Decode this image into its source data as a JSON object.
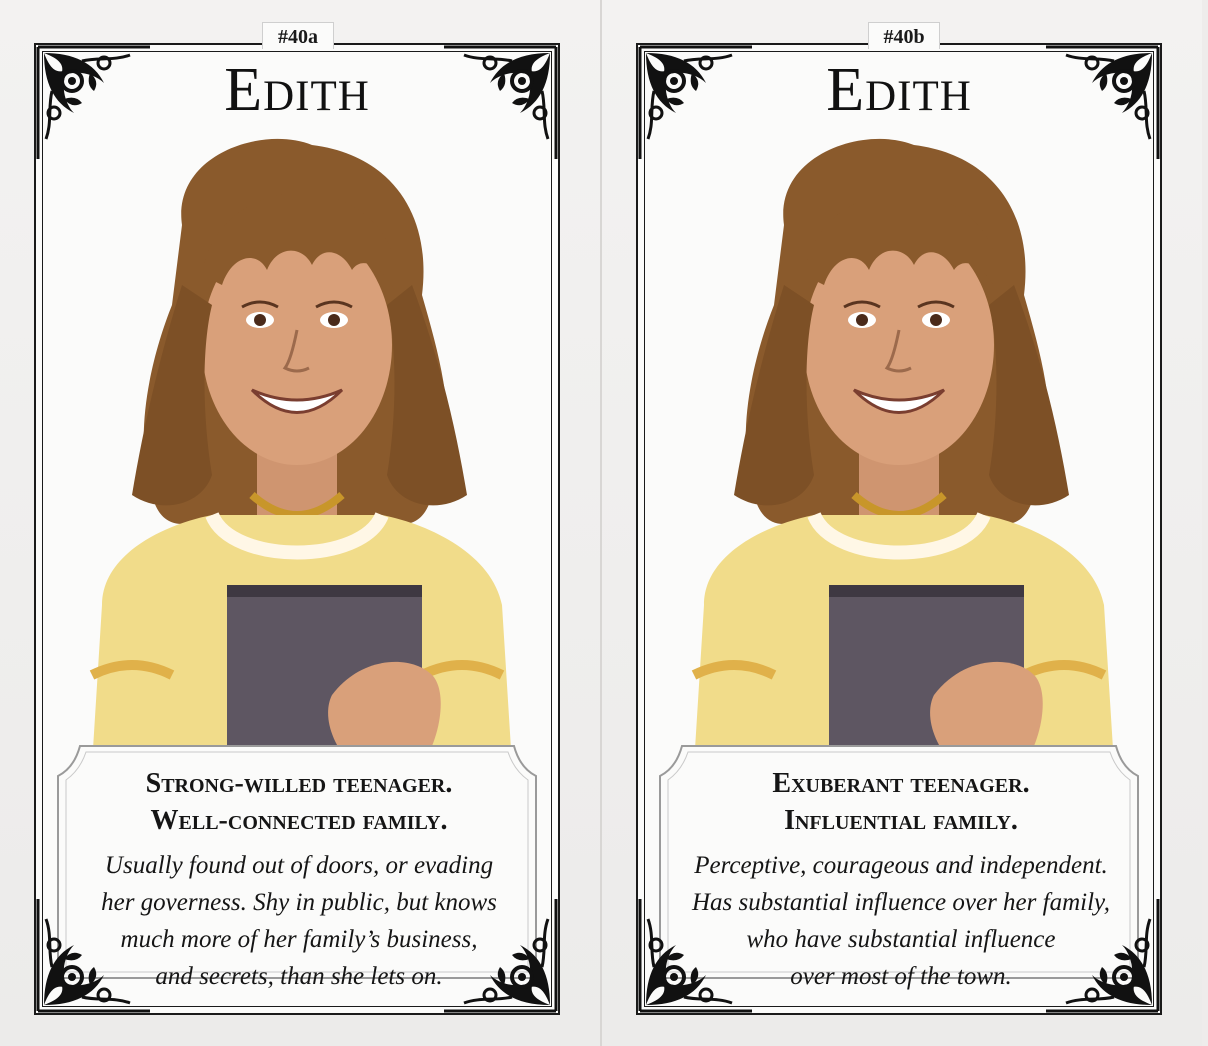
{
  "cards": [
    {
      "id": "#40a",
      "name": "Edith",
      "traits": [
        "Strong-willed teenager.",
        "Well-connected family."
      ],
      "description": [
        "Usually found out of doors, or evading",
        "her governess. Shy in public, but knows",
        "much more of her family’s business,",
        "and secrets, than she lets on."
      ]
    },
    {
      "id": "#40b",
      "name": "Edith",
      "traits": [
        "Exuberant teenager.",
        "Influential family."
      ],
      "description": [
        "Perceptive, courageous and independent.",
        "Has substantial influence over her family,",
        "who have substantial influence",
        "over most of the town."
      ]
    }
  ],
  "colors": {
    "hair": "#8a5a2c",
    "dress": "#f1dc8a",
    "book": "#5e5662",
    "skin": "#d9a07a",
    "ink": "#151515"
  }
}
